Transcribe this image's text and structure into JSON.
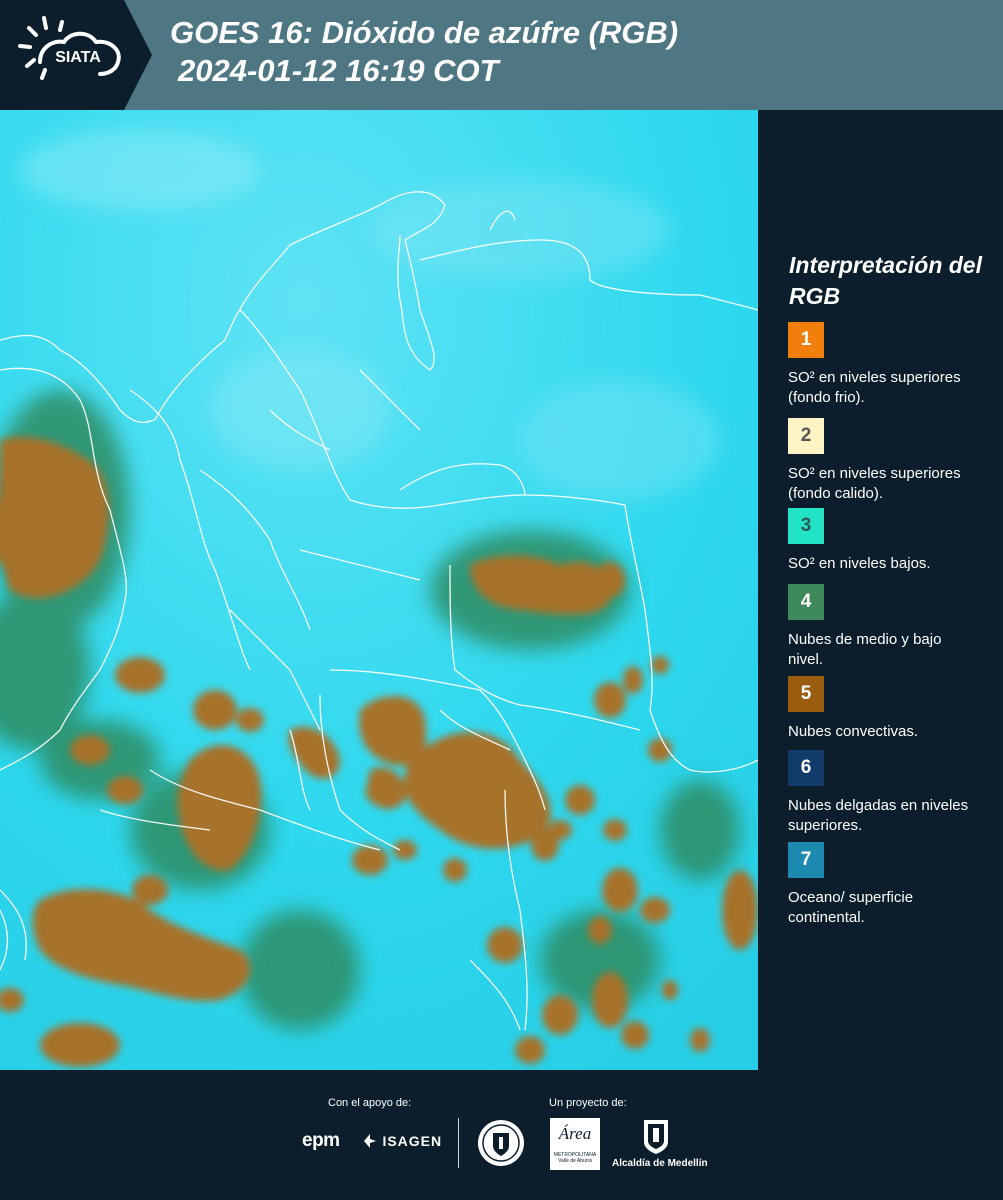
{
  "header": {
    "brand": "SIATA",
    "title_line1": "GOES 16: Dióxido de azúfre (RGB)",
    "title_line2": "2024-01-12 16:19 COT"
  },
  "legend": {
    "title": "Interpretación del RGB",
    "items": [
      {
        "number": "1",
        "color": "#f27f0c",
        "text_color": "#ffffff",
        "label": "SO² en niveles superiores (fondo frio)."
      },
      {
        "number": "2",
        "color": "#fdf4c4",
        "text_color": "#555555",
        "label": "SO² en niveles superiores (fondo calido)."
      },
      {
        "number": "3",
        "color": "#22e3c6",
        "text_color": "#2b5b55",
        "label": "SO² en niveles bajos."
      },
      {
        "number": "4",
        "color": "#3f8a5c",
        "text_color": "#ffffff",
        "label": "Nubes de medio y bajo nivel."
      },
      {
        "number": "5",
        "color": "#9a5d10",
        "text_color": "#ffffff",
        "label": "Nubes convectivas."
      },
      {
        "number": "6",
        "color": "#133b6b",
        "text_color": "#ffffff",
        "label": "Nubes delgadas en niveles superiores."
      },
      {
        "number": "7",
        "color": "#1c8ab0",
        "text_color": "#ffffff",
        "label": "Oceano/ superficie continental."
      }
    ]
  },
  "map": {
    "background_color": "#2fd7ee",
    "cloud_color": "#9b6a22",
    "border_color": "#ffffff"
  },
  "footer": {
    "support_label": "Con el apoyo de:",
    "project_label": "Un proyecto de:",
    "sponsors": [
      "epm",
      "ISAGEN"
    ],
    "partners": [
      "METROPOLITANA",
      "Valle de Aburrá",
      "Alcaldía de Medellín"
    ],
    "area_brand": "Área"
  }
}
